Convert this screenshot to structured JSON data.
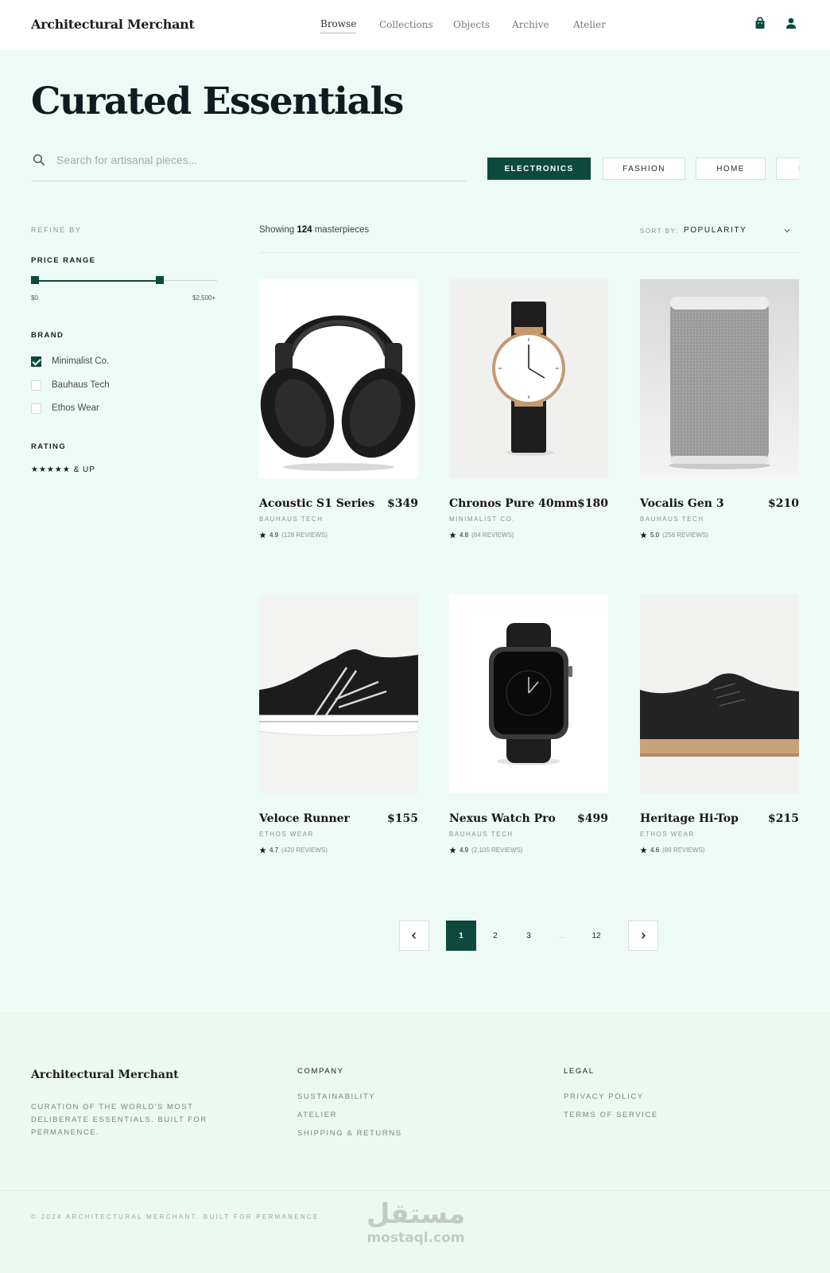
{
  "header": {
    "brand": "Architectural Merchant",
    "nav": [
      "Browse",
      "Collections",
      "Objects",
      "Archive",
      "Atelier"
    ],
    "active_nav": "Browse",
    "icons": [
      "shopping-bag-icon",
      "user-icon"
    ]
  },
  "hero": {
    "title": "Curated Essentials",
    "search_placeholder": "Search for artisanal pieces...",
    "categories": [
      "ELECTRONICS",
      "FASHION",
      "HOME",
      "BEAUTY"
    ],
    "active_category": "ELECTRONICS"
  },
  "sidebar": {
    "refine_label": "REFINE BY",
    "price_heading": "PRICE RANGE",
    "price_min": "$0",
    "price_max": "$2,500+",
    "price_range_fraction": [
      0.0,
      0.7
    ],
    "brand_heading": "BRAND",
    "brands": [
      {
        "label": "Minimalist Co.",
        "checked": true
      },
      {
        "label": "Bauhaus Tech",
        "checked": false
      },
      {
        "label": "Ethos Wear",
        "checked": false
      }
    ],
    "rating_heading": "RATING",
    "rating_filter": "★★★★★  & UP"
  },
  "results": {
    "showing_prefix": "Showing",
    "count": "124",
    "showing_suffix": "masterpieces",
    "sort_label": "SORT BY:",
    "sort_value": "POPULARITY"
  },
  "products": [
    {
      "name": "Acoustic S1 Series",
      "price": "$349",
      "brand": "BAUHAUS TECH",
      "rating": "4.9",
      "reviews": "(128 REVIEWS)",
      "image": "headphones"
    },
    {
      "name": "Chronos Pure 40mm",
      "price": "$180",
      "brand": "MINIMALIST CO.",
      "rating": "4.8",
      "reviews": "(84 REVIEWS)",
      "image": "wristwatch"
    },
    {
      "name": "Vocalis Gen 3",
      "price": "$210",
      "brand": "BAUHAUS TECH",
      "rating": "5.0",
      "reviews": "(256 REVIEWS)",
      "image": "smart-speaker"
    },
    {
      "name": "Veloce Runner",
      "price": "$155",
      "brand": "ETHOS WEAR",
      "rating": "4.7",
      "reviews": "(420 REVIEWS)",
      "image": "running-shoe"
    },
    {
      "name": "Nexus Watch Pro",
      "price": "$499",
      "brand": "BAUHAUS TECH",
      "rating": "4.9",
      "reviews": "(2,105 REVIEWS)",
      "image": "smartwatch"
    },
    {
      "name": "Heritage Hi-Top",
      "price": "$215",
      "brand": "ETHOS WEAR",
      "rating": "4.6",
      "reviews": "(89 REVIEWS)",
      "image": "leather-sneaker"
    }
  ],
  "pagination": {
    "pages": [
      "1",
      "2",
      "3",
      "...",
      "12"
    ],
    "current": "1"
  },
  "footer": {
    "brand": "Architectural Merchant",
    "description": "CURATION OF THE WORLD'S MOST DELIBERATE ESSENTIALS. BUILT FOR PERMANENCE.",
    "company_heading": "COMPANY",
    "company_links": [
      "SUSTAINABILITY",
      "ATELIER",
      "SHIPPING & RETURNS"
    ],
    "legal_heading": "LEGAL",
    "legal_links": [
      "PRIVACY POLICY",
      "TERMS OF SERVICE"
    ],
    "copyright": "© 2024 ARCHITECTURAL MERCHANT. BUILT FOR PERMANENCE.",
    "watermark_arabic": "مستقل",
    "watermark_latin": "mostaql.com"
  },
  "colors": {
    "accent": "#0d4a3d",
    "page_bg": "#eefaf5",
    "header_bg": "#ffffff"
  }
}
